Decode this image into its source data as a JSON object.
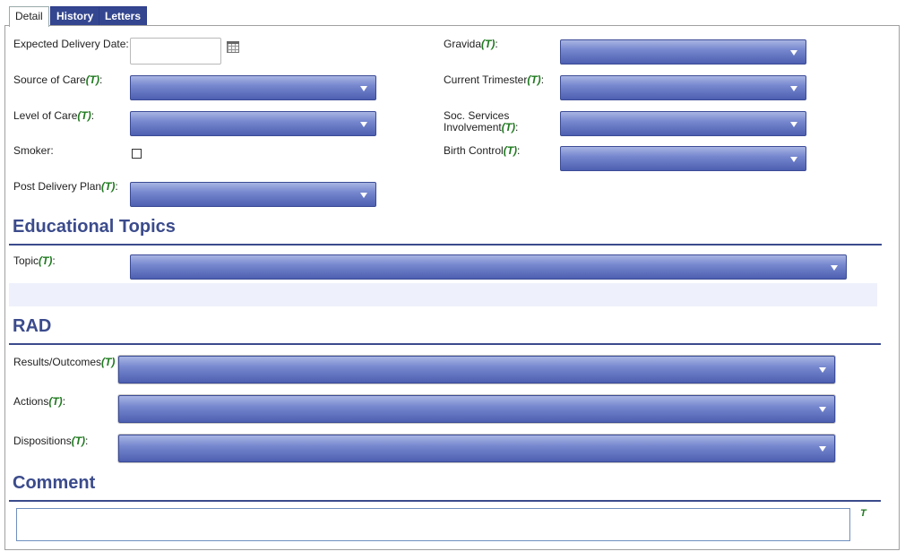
{
  "tabs": [
    {
      "label": "Detail",
      "active": true
    },
    {
      "label": "History",
      "active": false
    },
    {
      "label": "Letters",
      "active": false
    }
  ],
  "t_marker": "(T)",
  "left_fields": {
    "expected_delivery_date": {
      "label": "Expected Delivery Date:",
      "value": ""
    },
    "source_of_care": {
      "label": "Source of Care",
      "suffix": ":",
      "value": ""
    },
    "level_of_care": {
      "label": "Level of Care",
      "suffix": ":",
      "value": ""
    },
    "smoker": {
      "label": "Smoker:",
      "checked": false
    },
    "post_delivery_plan": {
      "label": "Post Delivery Plan",
      "suffix": ":",
      "value": ""
    }
  },
  "right_fields": {
    "gravida": {
      "label": "Gravida",
      "suffix": ":",
      "value": ""
    },
    "current_trimester": {
      "label": "Current Trimester",
      "suffix": ":",
      "value": ""
    },
    "soc_services": {
      "label_line1": "Soc. Services",
      "label_line2": "Involvement",
      "suffix": ":",
      "value": ""
    },
    "birth_control": {
      "label": "Birth Control",
      "suffix": ":",
      "value": ""
    }
  },
  "educational_topics": {
    "title": "Educational Topics",
    "topic": {
      "label": "Topic",
      "suffix": ":",
      "value": ""
    }
  },
  "rad": {
    "title": "RAD",
    "results_outcomes": {
      "label": "Results/Outcomes",
      "value": ""
    },
    "actions": {
      "label": "Actions",
      "suffix": ":",
      "value": ""
    },
    "dispositions": {
      "label": "Dispositions",
      "suffix": ":",
      "value": ""
    }
  },
  "comment": {
    "title": "Comment",
    "value": "",
    "marker": "T"
  },
  "colors": {
    "accent": "#3b4b8c",
    "tab_inactive": "#34468f",
    "t_green": "#1f7a1f"
  }
}
